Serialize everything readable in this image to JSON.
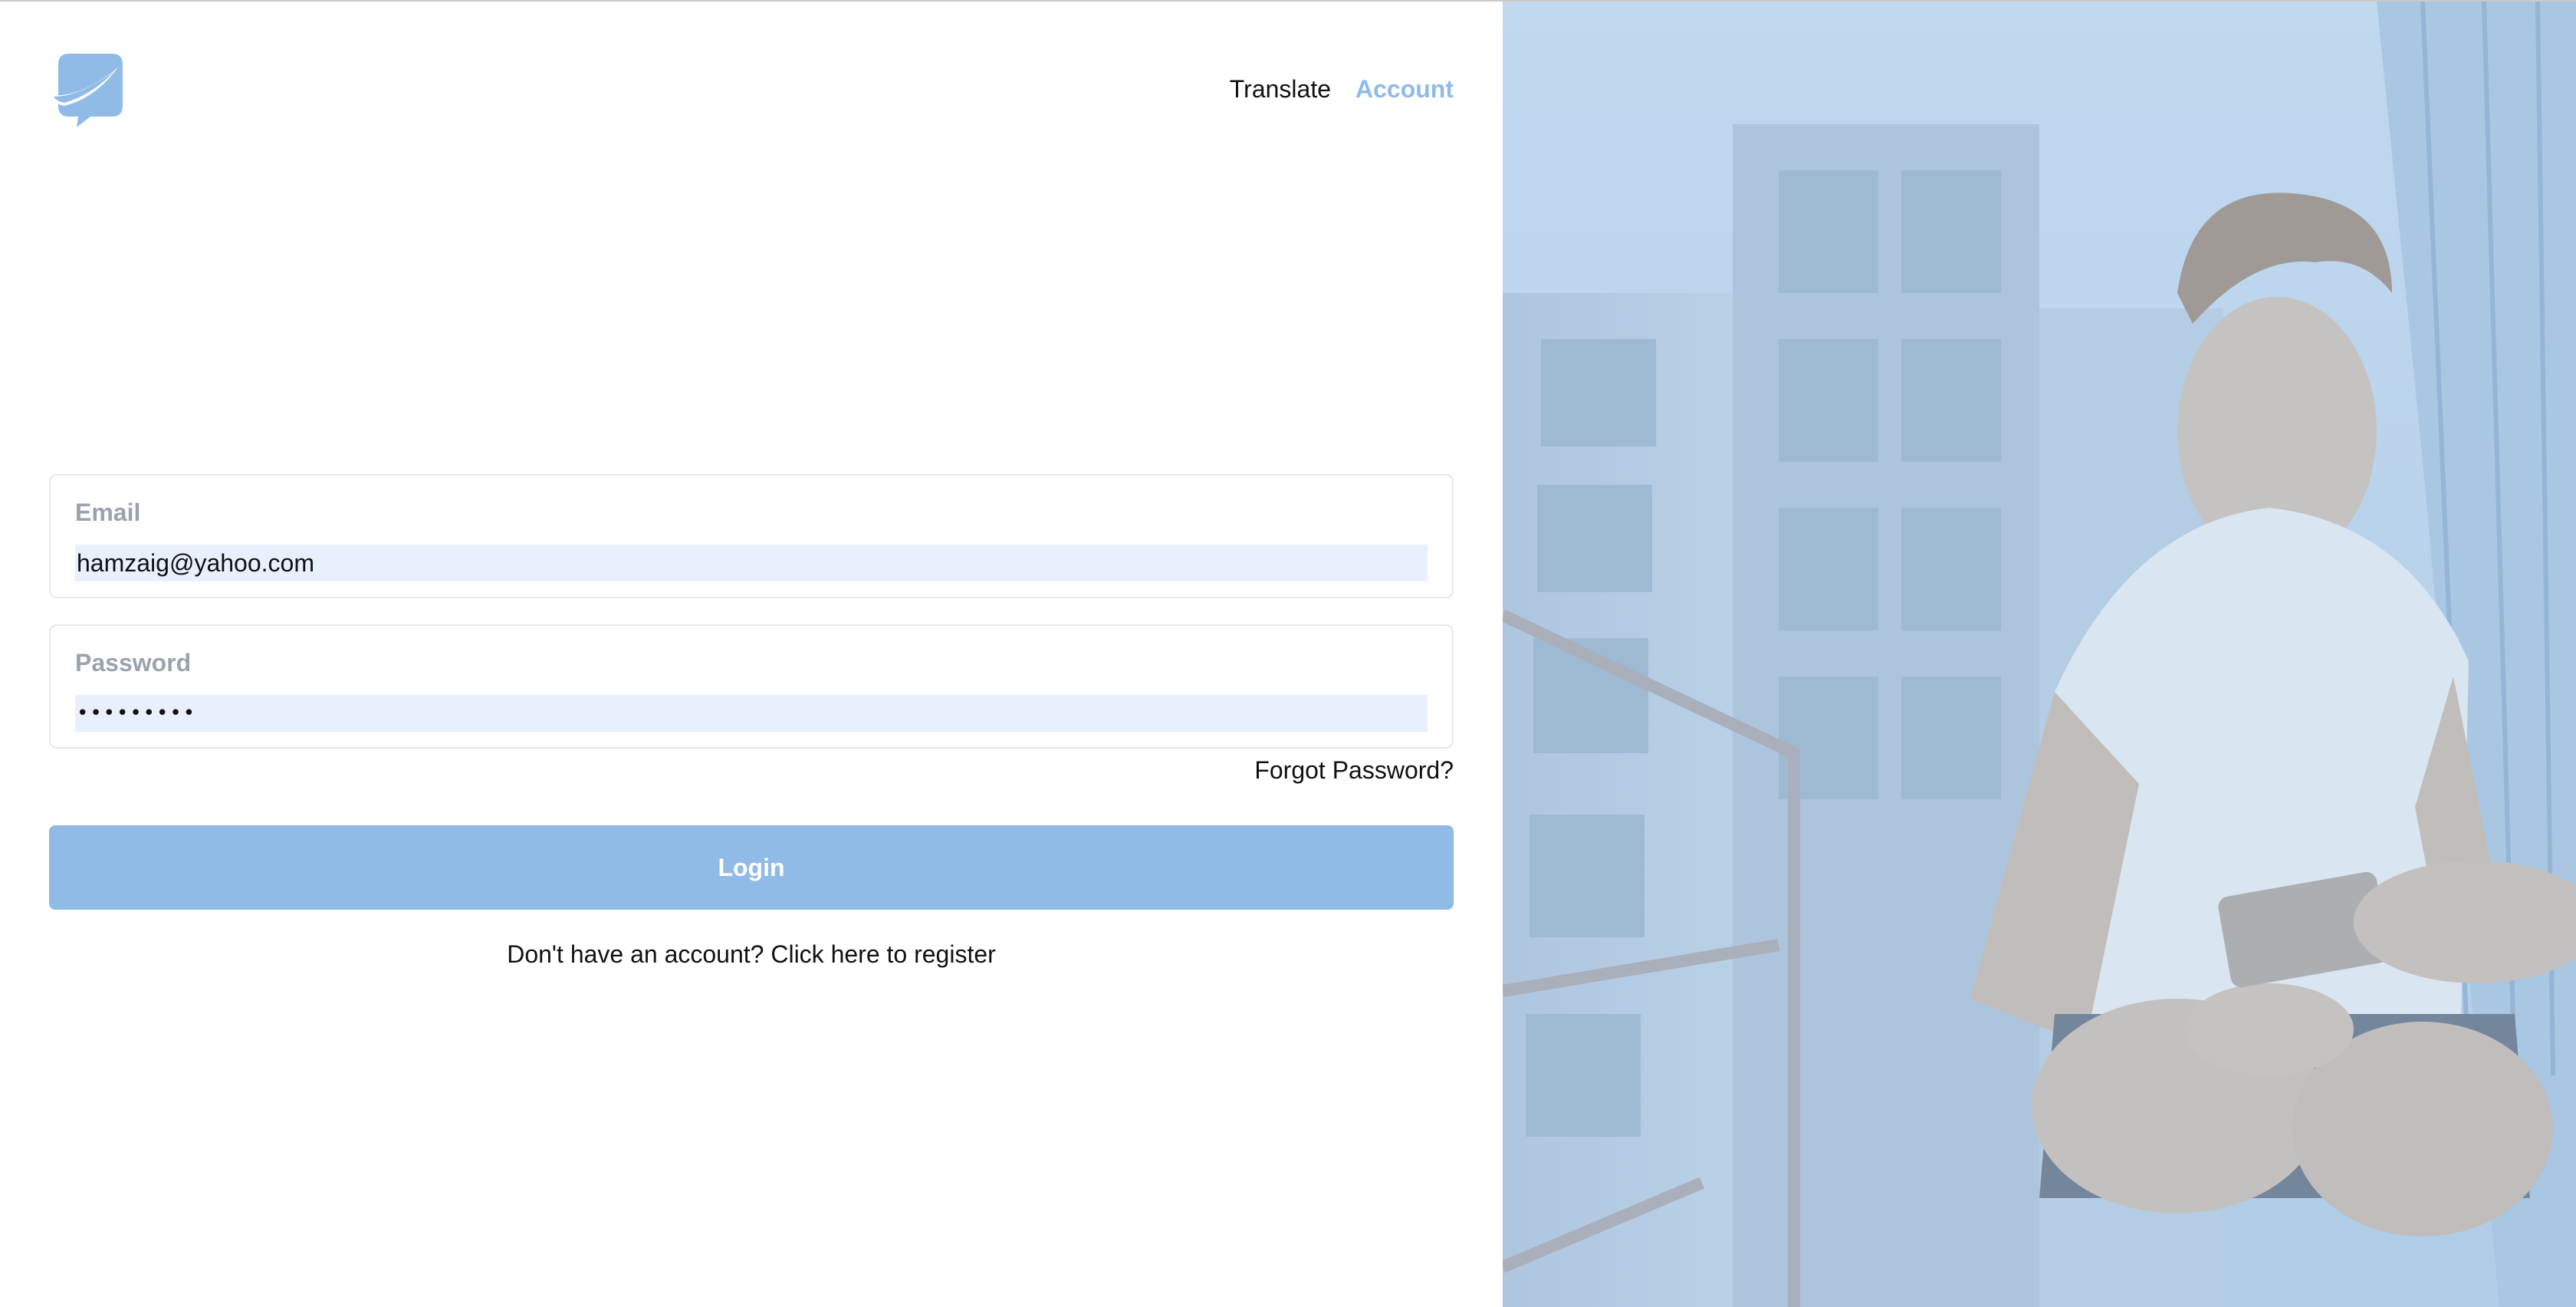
{
  "nav": {
    "items": [
      {
        "label": "Translate"
      },
      {
        "label": "Account"
      }
    ]
  },
  "form": {
    "email": {
      "label": "Email",
      "value": "hamzaig@yahoo.com"
    },
    "password": {
      "label": "Password",
      "value": "•••••••••"
    },
    "forgot_label": "Forgot Password?",
    "login_label": "Login",
    "register_label": "Don't have an account? Click here to register"
  },
  "icons": {
    "logo": "chat-bubble-logo-icon"
  },
  "colors": {
    "accent": "#8fbbe6",
    "input_bg": "#e8f0fd",
    "border": "#e6e8eb",
    "label": "#9aa3ad",
    "photo_tint": "#bcd6ee"
  }
}
